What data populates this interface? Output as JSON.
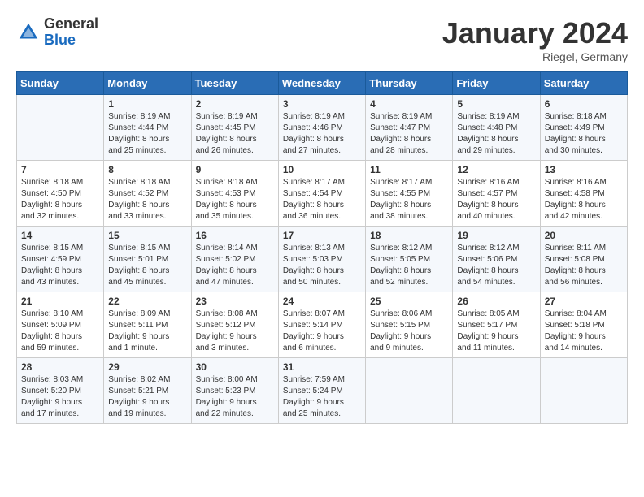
{
  "logo": {
    "general": "General",
    "blue": "Blue"
  },
  "title": "January 2024",
  "location": "Riegel, Germany",
  "days_header": [
    "Sunday",
    "Monday",
    "Tuesday",
    "Wednesday",
    "Thursday",
    "Friday",
    "Saturday"
  ],
  "weeks": [
    [
      {
        "num": "",
        "content": ""
      },
      {
        "num": "1",
        "content": "Sunrise: 8:19 AM\nSunset: 4:44 PM\nDaylight: 8 hours\nand 25 minutes."
      },
      {
        "num": "2",
        "content": "Sunrise: 8:19 AM\nSunset: 4:45 PM\nDaylight: 8 hours\nand 26 minutes."
      },
      {
        "num": "3",
        "content": "Sunrise: 8:19 AM\nSunset: 4:46 PM\nDaylight: 8 hours\nand 27 minutes."
      },
      {
        "num": "4",
        "content": "Sunrise: 8:19 AM\nSunset: 4:47 PM\nDaylight: 8 hours\nand 28 minutes."
      },
      {
        "num": "5",
        "content": "Sunrise: 8:19 AM\nSunset: 4:48 PM\nDaylight: 8 hours\nand 29 minutes."
      },
      {
        "num": "6",
        "content": "Sunrise: 8:18 AM\nSunset: 4:49 PM\nDaylight: 8 hours\nand 30 minutes."
      }
    ],
    [
      {
        "num": "7",
        "content": "Sunrise: 8:18 AM\nSunset: 4:50 PM\nDaylight: 8 hours\nand 32 minutes."
      },
      {
        "num": "8",
        "content": "Sunrise: 8:18 AM\nSunset: 4:52 PM\nDaylight: 8 hours\nand 33 minutes."
      },
      {
        "num": "9",
        "content": "Sunrise: 8:18 AM\nSunset: 4:53 PM\nDaylight: 8 hours\nand 35 minutes."
      },
      {
        "num": "10",
        "content": "Sunrise: 8:17 AM\nSunset: 4:54 PM\nDaylight: 8 hours\nand 36 minutes."
      },
      {
        "num": "11",
        "content": "Sunrise: 8:17 AM\nSunset: 4:55 PM\nDaylight: 8 hours\nand 38 minutes."
      },
      {
        "num": "12",
        "content": "Sunrise: 8:16 AM\nSunset: 4:57 PM\nDaylight: 8 hours\nand 40 minutes."
      },
      {
        "num": "13",
        "content": "Sunrise: 8:16 AM\nSunset: 4:58 PM\nDaylight: 8 hours\nand 42 minutes."
      }
    ],
    [
      {
        "num": "14",
        "content": "Sunrise: 8:15 AM\nSunset: 4:59 PM\nDaylight: 8 hours\nand 43 minutes."
      },
      {
        "num": "15",
        "content": "Sunrise: 8:15 AM\nSunset: 5:01 PM\nDaylight: 8 hours\nand 45 minutes."
      },
      {
        "num": "16",
        "content": "Sunrise: 8:14 AM\nSunset: 5:02 PM\nDaylight: 8 hours\nand 47 minutes."
      },
      {
        "num": "17",
        "content": "Sunrise: 8:13 AM\nSunset: 5:03 PM\nDaylight: 8 hours\nand 50 minutes."
      },
      {
        "num": "18",
        "content": "Sunrise: 8:12 AM\nSunset: 5:05 PM\nDaylight: 8 hours\nand 52 minutes."
      },
      {
        "num": "19",
        "content": "Sunrise: 8:12 AM\nSunset: 5:06 PM\nDaylight: 8 hours\nand 54 minutes."
      },
      {
        "num": "20",
        "content": "Sunrise: 8:11 AM\nSunset: 5:08 PM\nDaylight: 8 hours\nand 56 minutes."
      }
    ],
    [
      {
        "num": "21",
        "content": "Sunrise: 8:10 AM\nSunset: 5:09 PM\nDaylight: 8 hours\nand 59 minutes."
      },
      {
        "num": "22",
        "content": "Sunrise: 8:09 AM\nSunset: 5:11 PM\nDaylight: 9 hours\nand 1 minute."
      },
      {
        "num": "23",
        "content": "Sunrise: 8:08 AM\nSunset: 5:12 PM\nDaylight: 9 hours\nand 3 minutes."
      },
      {
        "num": "24",
        "content": "Sunrise: 8:07 AM\nSunset: 5:14 PM\nDaylight: 9 hours\nand 6 minutes."
      },
      {
        "num": "25",
        "content": "Sunrise: 8:06 AM\nSunset: 5:15 PM\nDaylight: 9 hours\nand 9 minutes."
      },
      {
        "num": "26",
        "content": "Sunrise: 8:05 AM\nSunset: 5:17 PM\nDaylight: 9 hours\nand 11 minutes."
      },
      {
        "num": "27",
        "content": "Sunrise: 8:04 AM\nSunset: 5:18 PM\nDaylight: 9 hours\nand 14 minutes."
      }
    ],
    [
      {
        "num": "28",
        "content": "Sunrise: 8:03 AM\nSunset: 5:20 PM\nDaylight: 9 hours\nand 17 minutes."
      },
      {
        "num": "29",
        "content": "Sunrise: 8:02 AM\nSunset: 5:21 PM\nDaylight: 9 hours\nand 19 minutes."
      },
      {
        "num": "30",
        "content": "Sunrise: 8:00 AM\nSunset: 5:23 PM\nDaylight: 9 hours\nand 22 minutes."
      },
      {
        "num": "31",
        "content": "Sunrise: 7:59 AM\nSunset: 5:24 PM\nDaylight: 9 hours\nand 25 minutes."
      },
      {
        "num": "",
        "content": ""
      },
      {
        "num": "",
        "content": ""
      },
      {
        "num": "",
        "content": ""
      }
    ]
  ]
}
